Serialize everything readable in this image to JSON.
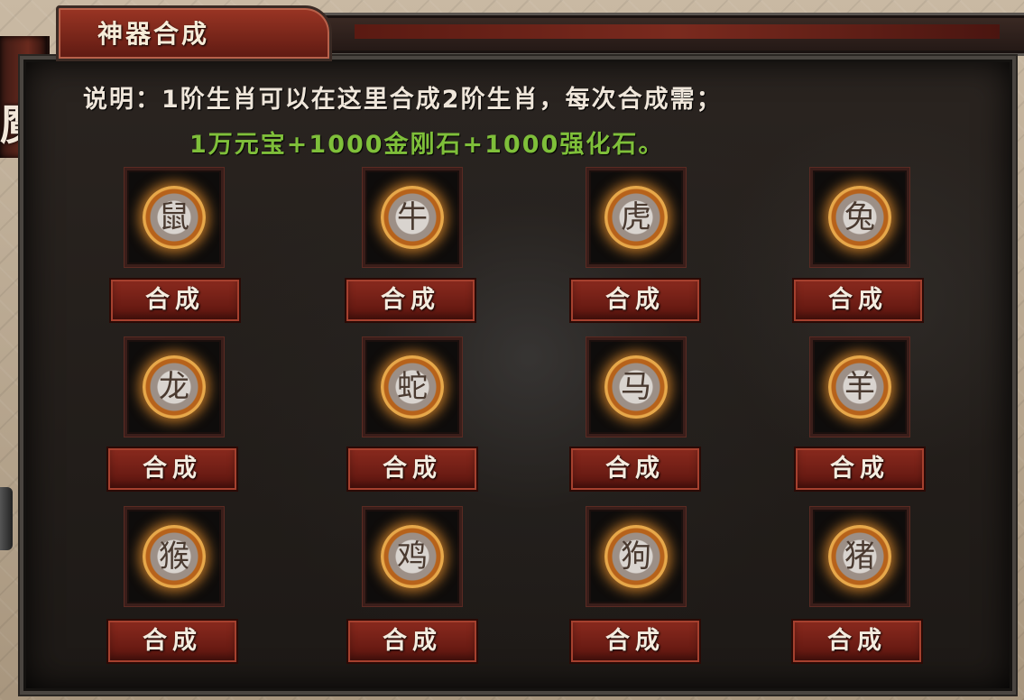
{
  "window": {
    "title": "神器合成",
    "side_char": "魔"
  },
  "description": {
    "line1": "说明：1阶生肖可以在这里合成2阶生肖，每次合成需；",
    "line2": "1万元宝+1000金刚石+1000强化石。"
  },
  "items": [
    {
      "name": "rat-emblem-icon",
      "glyph": "鼠",
      "button_label": "合成"
    },
    {
      "name": "ox-emblem-icon",
      "glyph": "牛",
      "button_label": "合成"
    },
    {
      "name": "tiger-emblem-icon",
      "glyph": "虎",
      "button_label": "合成"
    },
    {
      "name": "rabbit-emblem-icon",
      "glyph": "兔",
      "button_label": "合成"
    },
    {
      "name": "dragon-emblem-icon",
      "glyph": "龙",
      "button_label": "合成"
    },
    {
      "name": "snake-emblem-icon",
      "glyph": "蛇",
      "button_label": "合成"
    },
    {
      "name": "horse-emblem-icon",
      "glyph": "马",
      "button_label": "合成"
    },
    {
      "name": "goat-emblem-icon",
      "glyph": "羊",
      "button_label": "合成"
    },
    {
      "name": "monkey-emblem-icon",
      "glyph": "猴",
      "button_label": "合成"
    },
    {
      "name": "rooster-emblem-icon",
      "glyph": "鸡",
      "button_label": "合成"
    },
    {
      "name": "dog-emblem-icon",
      "glyph": "狗",
      "button_label": "合成"
    },
    {
      "name": "pig-emblem-icon",
      "glyph": "猪",
      "button_label": "合成"
    }
  ],
  "colors": {
    "accent_green": "#7fbf3a",
    "button_red": "#8a2a1e",
    "emblem_glow": "#e7a84a"
  }
}
